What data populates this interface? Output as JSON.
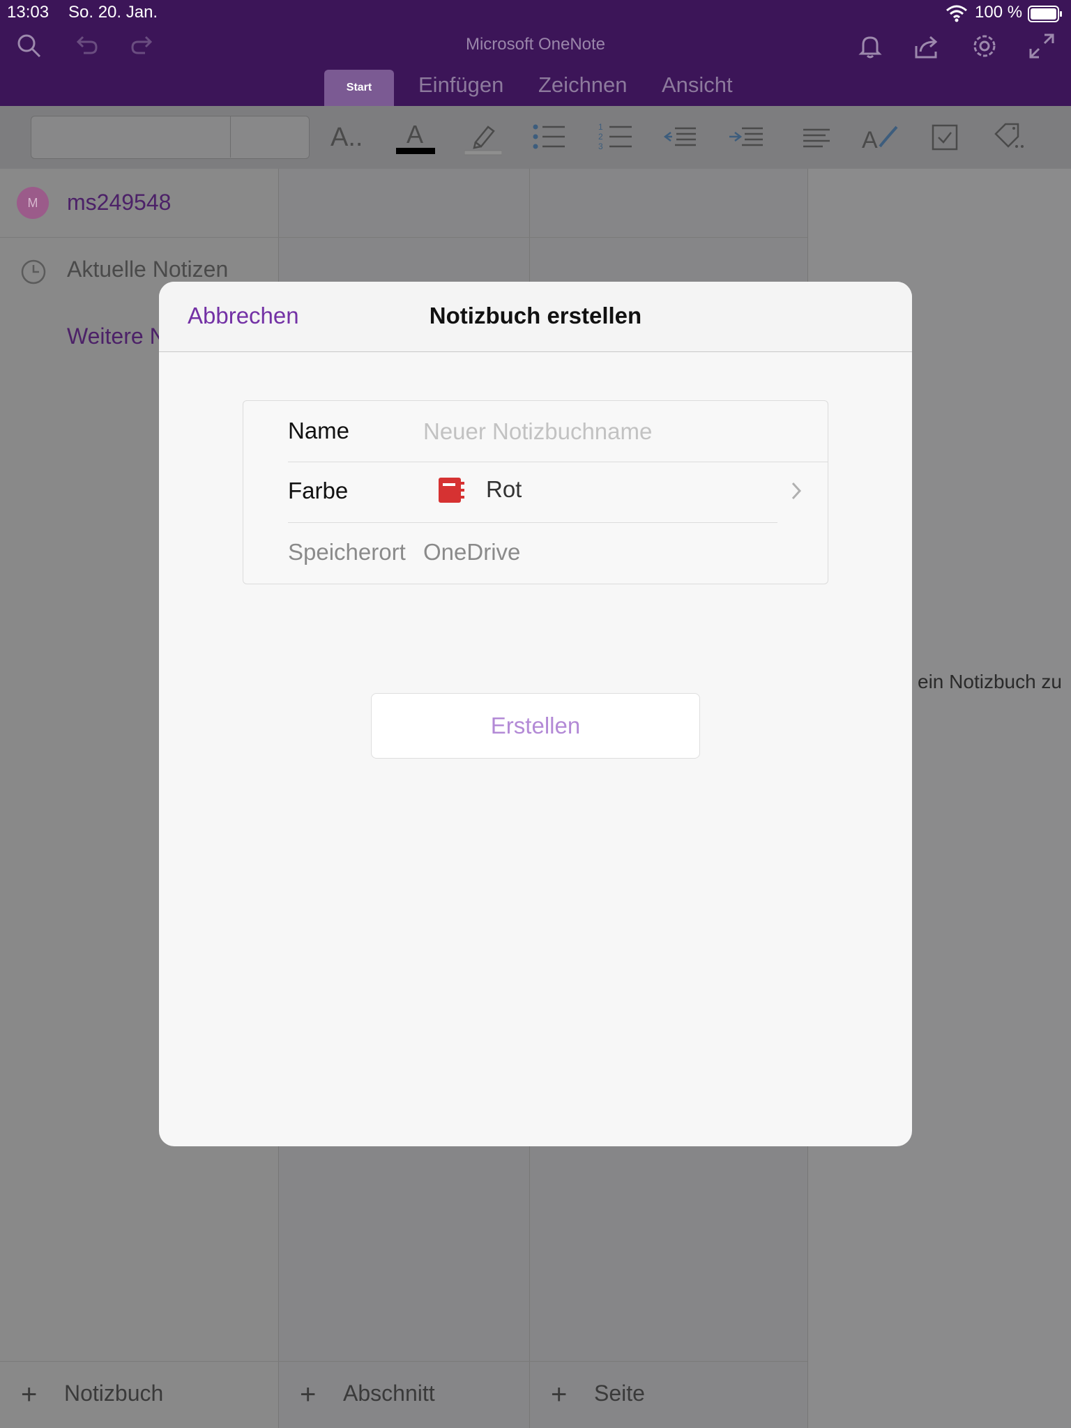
{
  "status_bar": {
    "time": "13:03",
    "date": "So. 20. Jan.",
    "battery": "100 %"
  },
  "app": {
    "title": "Microsoft OneNote"
  },
  "tabs": [
    {
      "label": "Start"
    },
    {
      "label": "Einfügen"
    },
    {
      "label": "Zeichnen"
    },
    {
      "label": "Ansicht"
    }
  ],
  "ribbon": {
    "font_style_label": "A..",
    "font_color_label": "A",
    "font_color": "#000000"
  },
  "sidebar": {
    "avatar_initial": "M",
    "account": "ms249548",
    "recent": "Aktuelle Notizen",
    "more": "Weitere Notizbücher"
  },
  "main": {
    "hint": "ein Notizbuch zu"
  },
  "bottom": {
    "add_notebook": "Notizbuch",
    "add_section": "Abschnitt",
    "add_page": "Seite"
  },
  "modal": {
    "title": "Notizbuch erstellen",
    "cancel_label": "Abbrechen",
    "name_label": "Name",
    "name_placeholder": "Neuer Notizbuchname",
    "name_value": "",
    "color_label": "Farbe",
    "color_value": "Rot",
    "color_hex": "#d63232",
    "location_label": "Speicherort",
    "location_value": "OneDrive",
    "create_label": "Erstellen"
  },
  "colors": {
    "brand": "#3c1558",
    "accent": "#7331a5",
    "create_disabled": "#b38ad6"
  }
}
